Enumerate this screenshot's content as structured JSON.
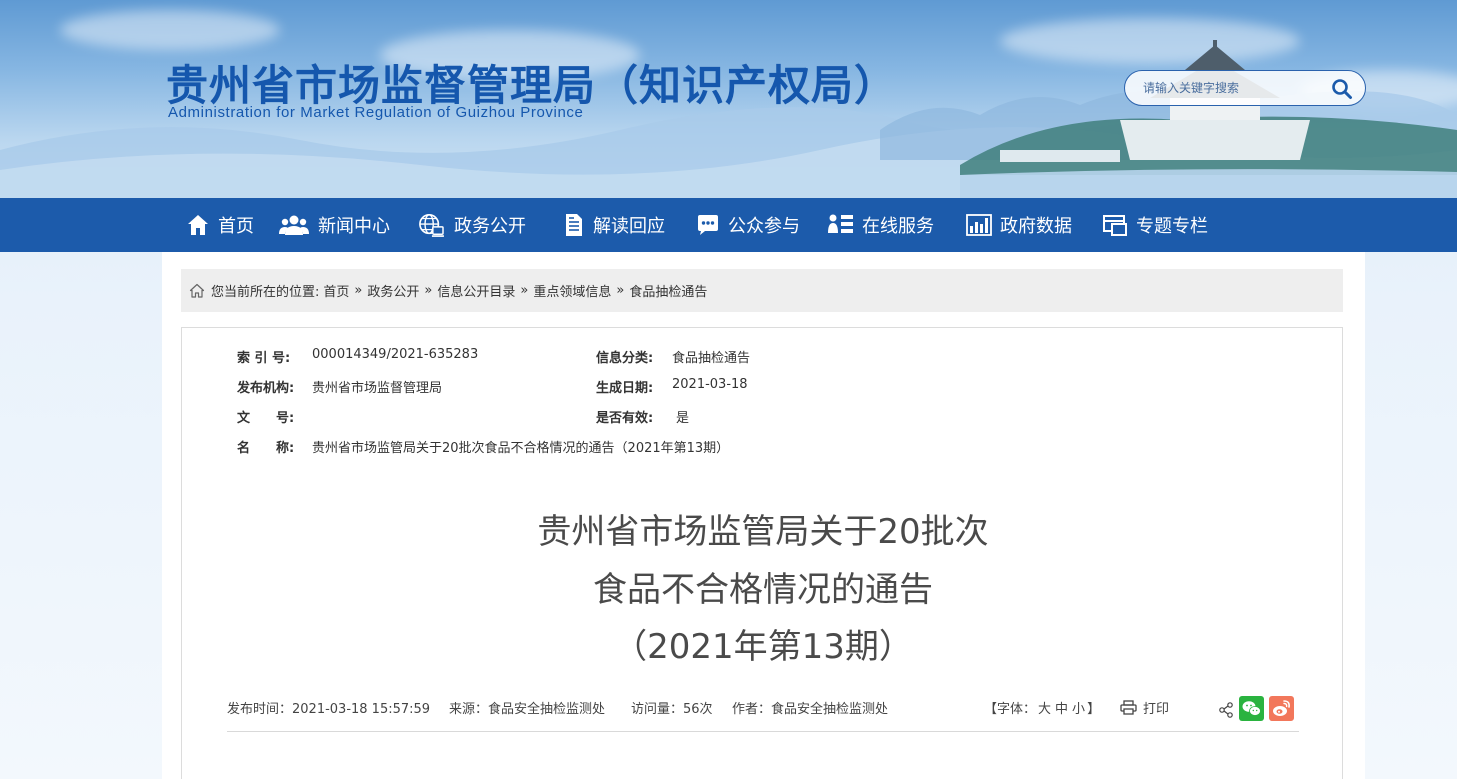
{
  "header": {
    "title_cn": "贵州省市场监督管理局（知识产权局）",
    "title_en": "Administration for Market Regulation of Guizhou Province",
    "search_placeholder": "请输入关键字搜索",
    "brand_color": "#1557ad"
  },
  "nav": {
    "color": "#1c5bab",
    "items": [
      {
        "label": "首页",
        "icon": "home-icon"
      },
      {
        "label": "新闻中心",
        "icon": "people-icon"
      },
      {
        "label": "政务公开",
        "icon": "globe-icon"
      },
      {
        "label": "解读回应",
        "icon": "document-icon"
      },
      {
        "label": "公众参与",
        "icon": "chat-icon"
      },
      {
        "label": "在线服务",
        "icon": "service-icon"
      },
      {
        "label": "政府数据",
        "icon": "bar-chart-icon"
      },
      {
        "label": "专题专栏",
        "icon": "window-icon"
      }
    ]
  },
  "breadcrumb": {
    "prefix": "您当前所在的位置:",
    "items": [
      "首页",
      "政务公开",
      "信息公开目录",
      "重点领域信息",
      "食品抽检通告"
    ],
    "separator": "»"
  },
  "meta": {
    "index_label": "索 引 号:",
    "index_value": "000014349/2021-635283",
    "category_label": "信息分类:",
    "category_value": "食品抽检通告",
    "publisher_label": "发布机构:",
    "publisher_value": "贵州省市场监督管理局",
    "date_label": "生成日期:",
    "date_value": "2021-03-18",
    "doc_no_label": "文　　号:",
    "doc_no_value": "",
    "valid_label": "是否有效:",
    "valid_value": "是",
    "name_label": "名　　称:",
    "name_value": "贵州省市场监管局关于20批次食品不合格情况的通告（2021年第13期）"
  },
  "article": {
    "title_line1": "贵州省市场监管局关于20批次",
    "title_line2": "食品不合格情况的通告",
    "title_line3": "（2021年第13期）",
    "publish_time": "发布时间：2021-03-18 15:57:59",
    "source": "来源：食品安全抽检监测处",
    "views": "访问量：56次",
    "author": "作者：食品安全抽检监测处",
    "font_label_open": "【字体：",
    "font_large": "大",
    "font_medium": "中",
    "font_small": "小",
    "font_label_close": "】",
    "print_label": "打印"
  }
}
